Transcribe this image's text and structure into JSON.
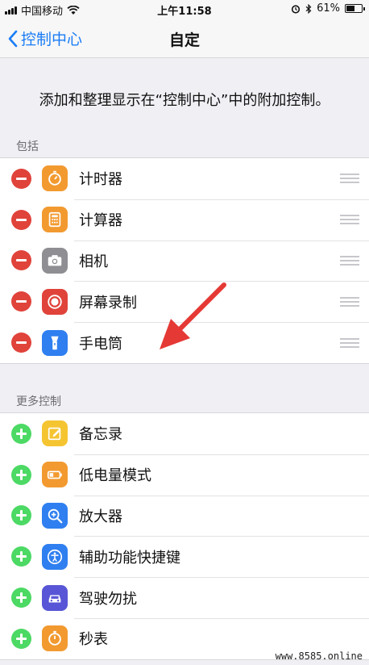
{
  "status_bar": {
    "carrier": "中国移动",
    "time": "上午11:58",
    "battery_percent": "61%",
    "battery_level": 0.61
  },
  "nav": {
    "back_label": "控制中心",
    "title": "自定"
  },
  "description": "添加和整理显示在“控制中心”中的附加控制。",
  "included": {
    "header": "包括",
    "items": [
      {
        "label": "计时器",
        "icon": "timer-icon",
        "color": "#f29a30"
      },
      {
        "label": "计算器",
        "icon": "calculator-icon",
        "color": "#f29a30"
      },
      {
        "label": "相机",
        "icon": "camera-icon",
        "color": "#8e8e93"
      },
      {
        "label": "屏幕录制",
        "icon": "screen-record-icon",
        "color": "#e0433a"
      },
      {
        "label": "手电筒",
        "icon": "flashlight-icon",
        "color": "#2f7ff0"
      }
    ]
  },
  "more": {
    "header": "更多控制",
    "items": [
      {
        "label": "备忘录",
        "icon": "notes-icon",
        "color": "#f5c431"
      },
      {
        "label": "低电量模式",
        "icon": "low-power-icon",
        "color": "#f29a30"
      },
      {
        "label": "放大器",
        "icon": "magnifier-icon",
        "color": "#2f7ff0"
      },
      {
        "label": "辅助功能快捷键",
        "icon": "accessibility-icon",
        "color": "#2f7ff0"
      },
      {
        "label": "驾驶勿扰",
        "icon": "car-icon",
        "color": "#5856d6"
      },
      {
        "label": "秒表",
        "icon": "stopwatch-icon",
        "color": "#f29a30"
      }
    ]
  },
  "watermark": "www.8585.online"
}
